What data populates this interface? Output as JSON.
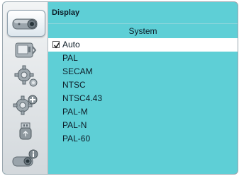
{
  "menu": {
    "section_title": "Display",
    "sub_title": "System",
    "selected_index": 0,
    "options": [
      {
        "label": "Auto",
        "checked": true
      },
      {
        "label": "PAL",
        "checked": false
      },
      {
        "label": "SECAM",
        "checked": false
      },
      {
        "label": "NTSC",
        "checked": false
      },
      {
        "label": "NTSC4.43",
        "checked": false
      },
      {
        "label": "PAL-M",
        "checked": false
      },
      {
        "label": "PAL-N",
        "checked": false
      },
      {
        "label": "PAL-60",
        "checked": false
      }
    ]
  },
  "rail": {
    "icons": [
      "projector-display-icon",
      "input-setting-icon",
      "gear-icon",
      "gear-add-icon",
      "usb-icon",
      "projector-info-icon"
    ],
    "active_index": 0
  },
  "colors": {
    "menu_bg": "#5ecfd6",
    "selected_row": "#ffffff",
    "rail_bg": "#e3e7ea"
  }
}
